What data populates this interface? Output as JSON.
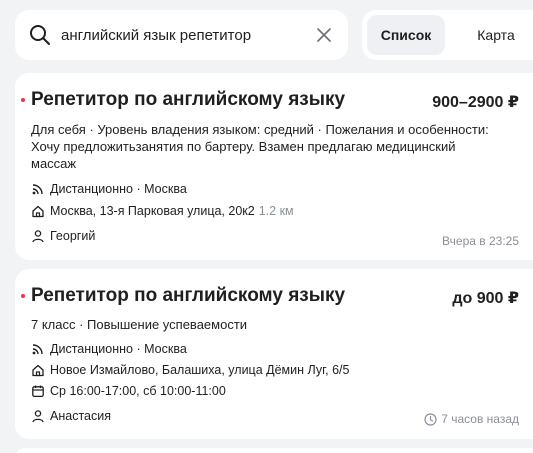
{
  "search": {
    "value": "английский язык репетитор"
  },
  "view_tabs": [
    {
      "label": "Список",
      "active": true
    },
    {
      "label": "Карта",
      "active": false
    }
  ],
  "accent_color": "#e8384f",
  "results": [
    {
      "title": "Репетитор по английскому языку",
      "price": "900–2900 ₽",
      "description": "Для себя · Уровень владения языком: средний · Пожелания и особенности: Хочу предложитьзанятия по бартеру. Взамен предлагаю медицинский массаж",
      "format": "Дистанционно · Москва",
      "address": "Москва, 13-я Парковая улица, 20к2",
      "distance": "1.2 км",
      "client": "Георгий",
      "time": "Вчера в 23:25"
    },
    {
      "title": "Репетитор по английскому языку",
      "price": "до 900 ₽",
      "description": "7 класс · Повышение успеваемости",
      "format": "Дистанционно · Москва",
      "address": "Новое Измайлово, Балашиха, улица Дёмин Луг, 6/5",
      "schedule": "Ср 16:00-17:00, сб 10:00-11:00",
      "client": "Анастасия",
      "time": "7 часов назад"
    }
  ]
}
